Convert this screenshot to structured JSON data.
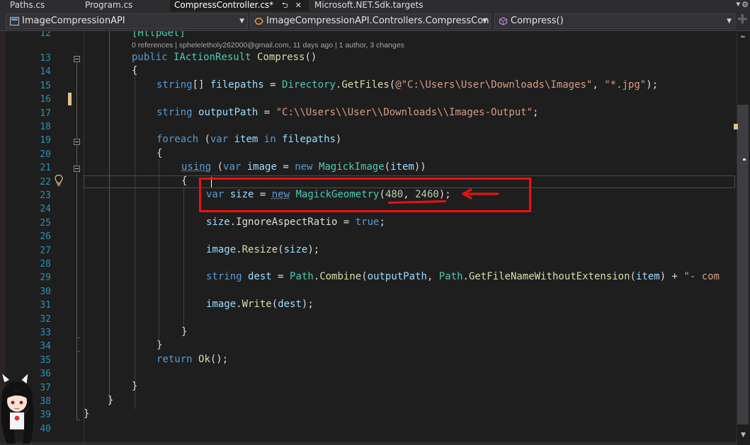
{
  "tabs": [
    {
      "label": "Paths.cs",
      "active": false
    },
    {
      "label": "Program.cs",
      "active": false
    },
    {
      "label": "CompressController.cs*",
      "active": true,
      "pin_icon": "pin-icon",
      "close_icon": "close-icon"
    },
    {
      "label": "Microsoft.NET.Sdk.targets",
      "active": false
    }
  ],
  "tab_overflow_icon": "overflow-dropdown-icon",
  "nav": {
    "project": "ImageCompressionAPI",
    "type": "ImageCompressionAPI.Controllers.CompressCon",
    "member": "Compress()"
  },
  "codelens": "0 references | spheleletholy262000@gmail.com, 11 days ago | 1 author, 3 changes",
  "line_numbers": [
    "12",
    "13",
    "14",
    "15",
    "16",
    "17",
    "18",
    "19",
    "20",
    "21",
    "22",
    "23",
    "24",
    "25",
    "26",
    "27",
    "28",
    "29",
    "30",
    "31",
    "32",
    "33",
    "34",
    "35",
    "36",
    "37",
    "38",
    "39",
    "40"
  ],
  "code": {
    "l12_attr": "[HttpGet]",
    "l13_kw1": "public",
    "l13_type": "IActionResult",
    "l13_fn": "Compress",
    "l13_rest": "()",
    "l14": "{",
    "l15_kw": "string",
    "l15_a": "[] ",
    "l15_var": "filepaths",
    "l15_b": " = ",
    "l15_type": "Directory",
    "l15_c": ".",
    "l15_fn": "GetFiles",
    "l15_d": "(",
    "l15_str1": "@\"C:\\Users\\User\\Downloads\\Images\"",
    "l15_e": ", ",
    "l15_str2": "\"*.jpg\"",
    "l15_f": ");",
    "l17_kw": "string",
    "l17_var": "outputPath",
    "l17_a": " = ",
    "l17_str": "\"C:\\\\Users\\\\User\\\\Downloads\\\\Images-Output\"",
    "l17_b": ";",
    "l19_kw": "foreach",
    "l19_a": " (",
    "l19_kw2": "var",
    "l19_var": "item",
    "l19_kw3": "in",
    "l19_var2": "filepaths",
    "l19_b": ")",
    "l20": "{",
    "l21_kw": "using",
    "l21_a": " (",
    "l21_kw2": "var",
    "l21_var": "image",
    "l21_b": " = ",
    "l21_kw3": "new",
    "l21_type": "MagickImage",
    "l21_c": "(",
    "l21_var2": "item",
    "l21_d": "))",
    "l22": "{",
    "l23_kw": "var",
    "l23_var": "size",
    "l23_a": " = ",
    "l23_kw2": "new",
    "l23_type": "MagickGeometry",
    "l23_b": "(",
    "l23_n1": "480",
    "l23_c": ", ",
    "l23_n2": "2460",
    "l23_d": ");",
    "l25_var": "size",
    "l25_a": ".",
    "l25_prop": "IgnoreAspectRatio",
    "l25_b": " = ",
    "l25_kw": "true",
    "l25_c": ";",
    "l27_var": "image",
    "l27_a": ".",
    "l27_fn": "Resize",
    "l27_b": "(",
    "l27_var2": "size",
    "l27_c": ");",
    "l29_kw": "string",
    "l29_var": "dest",
    "l29_a": " = ",
    "l29_type": "Path",
    "l29_b": ".",
    "l29_fn": "Combine",
    "l29_c": "(",
    "l29_var2": "outputPath",
    "l29_d": ", ",
    "l29_type2": "Path",
    "l29_e": ".",
    "l29_fn2": "GetFileNameWithoutExtension",
    "l29_f": "(",
    "l29_var3": "item",
    "l29_g": ") + ",
    "l29_str": "\"- com",
    "l31_var": "image",
    "l31_a": ".",
    "l31_fn": "Write",
    "l31_b": "(",
    "l31_var2": "dest",
    "l31_c": ");",
    "l33": "}",
    "l34": "}",
    "l35_kw": "return",
    "l35_fn": "Ok",
    "l35_a": "();",
    "l37": "}",
    "l38": "}",
    "l39": "}"
  },
  "colors": {
    "keyword": "#569cd6",
    "type": "#4ec9b0",
    "method": "#dcdcaa",
    "variable": "#9cdcfe",
    "string": "#d69d85",
    "number": "#b5cea8",
    "annotation": "#f01010",
    "line_number": "#2b91af",
    "change_marker": "#e2c08d"
  },
  "icons": {
    "project_icon": "csharp-project-icon",
    "type_icon": "class-icon",
    "member_icon": "method-cube-icon",
    "quick_actions": "lightbulb-icon",
    "split_editor": "split-editor-icon"
  }
}
